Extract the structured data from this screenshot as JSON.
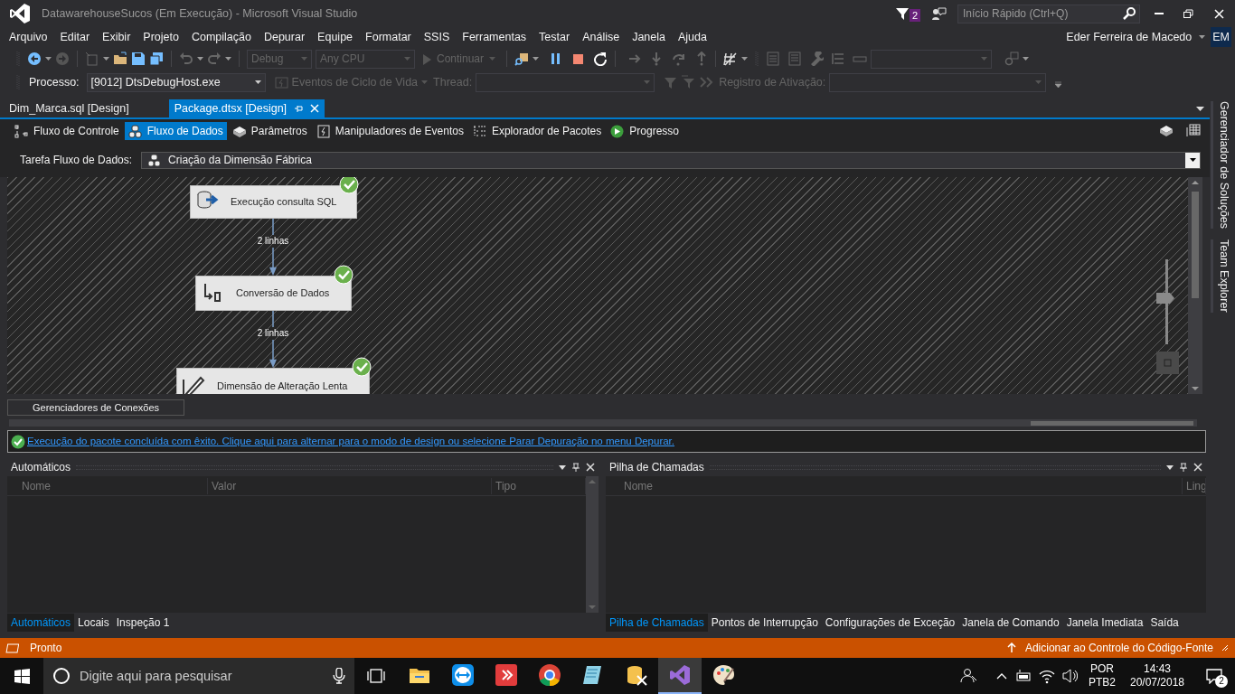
{
  "window": {
    "title": "DatawarehouseSucos (Em Execução) - Microsoft Visual Studio"
  },
  "title_bar": {
    "notification_count": "2",
    "quick_launch": {
      "placeholder": "Início Rápido (Ctrl+Q)"
    }
  },
  "menu": [
    "Arquivo",
    "Editar",
    "Exibir",
    "Projeto",
    "Compilação",
    "Depurar",
    "Equipe",
    "Formatar",
    "SSIS",
    "Ferramentas",
    "Testar",
    "Análise",
    "Janela",
    "Ajuda"
  ],
  "account": {
    "user": "Eder Ferreira de Macedo",
    "initials": "EM"
  },
  "standard_toolbar": {
    "configuration": "Debug",
    "platform": "Any CPU",
    "continue": "Continuar"
  },
  "debug_location_toolbar": {
    "process_label": "Processo:",
    "process": "[9012] DtsDebugHost.exe",
    "lifecycle_events": "Eventos de Ciclo de Vida",
    "thread_label": "Thread:",
    "stack_frame_label": "Registro de Ativação:"
  },
  "document_tabs": [
    {
      "label": "Dim_Marca.sql [Design]",
      "selected": false
    },
    {
      "label": "Package.dtsx [Design]",
      "selected": true
    }
  ],
  "designer_tabs": [
    {
      "label": "Fluxo de Controle",
      "kind": "control_flow",
      "selected": false
    },
    {
      "label": "Fluxo de Dados",
      "kind": "data_flow",
      "selected": true
    },
    {
      "label": "Parâmetros",
      "kind": "parameters",
      "selected": false
    },
    {
      "label": "Manipuladores de Eventos",
      "kind": "event_handlers",
      "selected": false
    },
    {
      "label": "Explorador de Pacotes",
      "kind": "explorer",
      "selected": false
    },
    {
      "label": "Progresso",
      "kind": "progress",
      "selected": false
    }
  ],
  "data_flow_task": {
    "label": "Tarefa Fluxo de Dados:",
    "value": "Criação da Dimensão Fábrica"
  },
  "canvas": {
    "nodes": [
      {
        "label": "Execução consulta SQL",
        "kind": "source",
        "succeeded": true
      },
      {
        "label": "Conversão de Dados",
        "kind": "conversion",
        "succeeded": true
      },
      {
        "label": "Dimensão de Alteração Lenta",
        "kind": "scd",
        "succeeded": true
      }
    ],
    "paths": [
      {
        "label": "2 linhas"
      },
      {
        "label": "2 linhas"
      }
    ],
    "zoom_slider": {
      "level": 0.55
    }
  },
  "connection_managers": {
    "title": "Gerenciadores de Conexões"
  },
  "message": "Execução do pacote concluída com êxito. Clique aqui para alternar para o modo de design ou selecione Parar Depuração no menu Depurar.",
  "autos_panel": {
    "title": "Automáticos",
    "columns": [
      "Nome",
      "Valor",
      "Tipo"
    ],
    "tabs": [
      {
        "label": "Automáticos",
        "selected": true
      },
      {
        "label": "Locais",
        "selected": false
      },
      {
        "label": "Inspeção 1",
        "selected": false
      }
    ]
  },
  "call_stack_panel": {
    "title": "Pilha de Chamadas",
    "columns": [
      "Nome",
      "Ling"
    ],
    "tabs": [
      {
        "label": "Pilha de Chamadas",
        "selected": true
      },
      {
        "label": "Pontos de Interrupção",
        "selected": false
      },
      {
        "label": "Configurações de Exceção",
        "selected": false
      },
      {
        "label": "Janela de Comando",
        "selected": false
      },
      {
        "label": "Janela Imediata",
        "selected": false
      },
      {
        "label": "Saída",
        "selected": false
      }
    ]
  },
  "side_tabs": [
    "Gerenciador de Soluções",
    "Team Explorer"
  ],
  "status_bar": {
    "text": "Pronto",
    "source_control": "Adicionar ao Controle do Código-Fonte"
  },
  "taskbar": {
    "search_placeholder": "Digite aqui para pesquisar",
    "apps": [
      {
        "kind": "explorer",
        "selected": false
      },
      {
        "kind": "teamviewer",
        "selected": false
      },
      {
        "kind": "remote",
        "selected": false
      },
      {
        "kind": "chrome",
        "selected": false
      },
      {
        "kind": "notes",
        "selected": false
      },
      {
        "kind": "database",
        "selected": false
      },
      {
        "kind": "visualstudio",
        "selected": true
      },
      {
        "kind": "paint",
        "selected": false
      }
    ],
    "language": "POR",
    "layout": "PTB2",
    "time": "14:43",
    "date": "20/07/2018",
    "notification_count": "2"
  }
}
